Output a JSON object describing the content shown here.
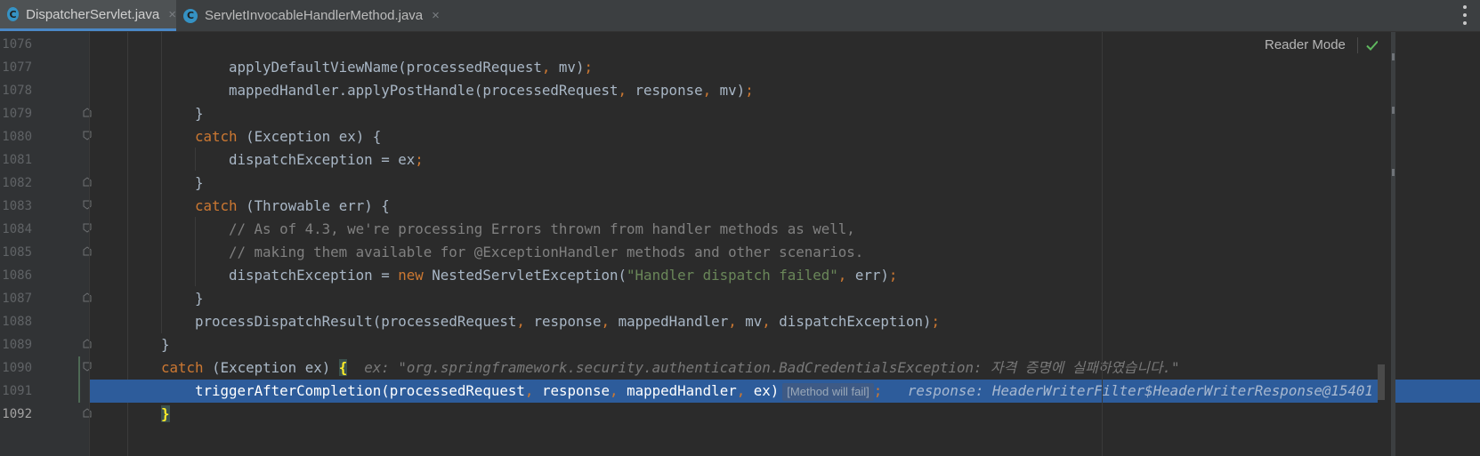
{
  "tabs": [
    {
      "label": "DispatcherServlet.java",
      "icon": "java-class-icon",
      "active": true
    },
    {
      "label": "ServletInvocableHandlerMethod.java",
      "icon": "java-class-icon",
      "active": false
    }
  ],
  "tab_icon_letter": "C",
  "tab_close_glyph": "×",
  "reader_mode": "Reader Mode",
  "line_numbers": [
    "1076",
    "1077",
    "1078",
    "1079",
    "1080",
    "1081",
    "1082",
    "1083",
    "1084",
    "1085",
    "1086",
    "1087",
    "1088",
    "1089",
    "1090",
    "1091",
    "1092"
  ],
  "current_line": "1092",
  "code": {
    "l1077": {
      "a": "applyDefaultViewName(processedRequest",
      "b": ", ",
      "c": "mv)",
      "d": ";"
    },
    "l1078": {
      "a": "mappedHandler.applyPostHandle(processedRequest",
      "b": ", ",
      "c": "response",
      "d": ", ",
      "e": "mv)",
      "f": ";"
    },
    "l1079": "}",
    "l1080": {
      "kw": "catch",
      "rest": " (Exception ex) {"
    },
    "l1081": {
      "a": "dispatchException = ex",
      "b": ";"
    },
    "l1082": "}",
    "l1083": {
      "kw": "catch",
      "rest": " (Throwable err) {"
    },
    "l1084": "// As of 4.3, we're processing Errors thrown from handler methods as well,",
    "l1085": "// making them available for @ExceptionHandler methods and other scenarios.",
    "l1086": {
      "a": "dispatchException = ",
      "kw": "new",
      "b": " NestedServletException(",
      "str": "\"Handler dispatch failed\"",
      "c": ", ",
      "d": "err)",
      "e": ";"
    },
    "l1087": "}",
    "l1088": {
      "a": "processDispatchResult(processedRequest",
      "b": ", ",
      "c": "response",
      "d": ", ",
      "e": "mappedHandler",
      "f": ", ",
      "g": "mv",
      "h": ", ",
      "i": "dispatchException)",
      "j": ";"
    },
    "l1089": "}",
    "l1090": {
      "kw": "catch",
      "rest": " (Exception ex) ",
      "brace": "{",
      "inlay": "ex: \"org.springframework.security.authentication.BadCredentialsException: 자격 증명에 실패하였습니다.\""
    },
    "l1091": {
      "a": "triggerAfterCompletion(processedRequest",
      "b": ", ",
      "c": "response",
      "d": ", ",
      "e": "mappedHandler",
      "f": ", ",
      "g": "ex)",
      "hint": "[Method will fail]",
      "h": ";",
      "inlay": "response: HeaderWriterFilter$HeaderWriterResponse@15401"
    },
    "l1092": "}"
  }
}
